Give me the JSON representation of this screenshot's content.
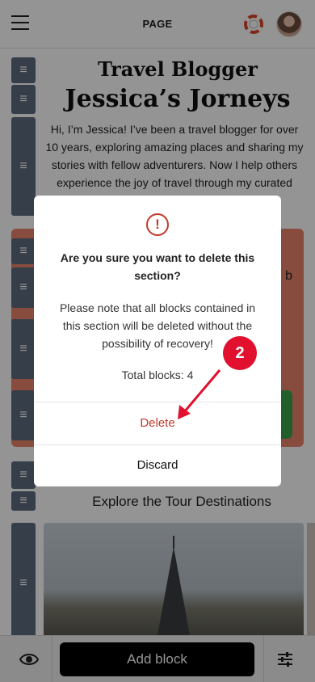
{
  "topbar": {
    "title": "PAGE",
    "menu_icon": "hamburger-menu-icon",
    "help_icon": "lifebuoy-icon",
    "avatar_icon": "user-avatar"
  },
  "content": {
    "hero_title_line1": "Travel Blogger",
    "hero_title_line2": "Jessica’s Jorneys",
    "bio": "Hi, I’m Jessica! I’ve been a travel blogger for over 10 years, exploring amazing places and sharing my stories with fellow adventurers. Now I help others experience the joy of travel through my curated tours to Las Vegas, Paris, and Bangkok.",
    "section_partial_text": "b",
    "explore_heading": "Explore the Tour Destinations",
    "handle_icon": "drag-handle-icon"
  },
  "modal": {
    "icon": "warning-circle-icon",
    "title": "Are you sure you want to delete this section?",
    "body": "Please note that all blocks contained in this section will be deleted without the possibility of recovery!",
    "total_blocks": "Total blocks: 4",
    "delete_label": "Delete",
    "discard_label": "Discard"
  },
  "annotation": {
    "step_number": "2"
  },
  "bottombar": {
    "preview_icon": "eye-icon",
    "add_block_label": "Add block",
    "settings_icon": "sliders-icon"
  },
  "colors": {
    "accent_red": "#c0392b",
    "badge_red": "#e0102e",
    "section_orange": "#e9836a",
    "handle_slate": "#5d6b80"
  }
}
